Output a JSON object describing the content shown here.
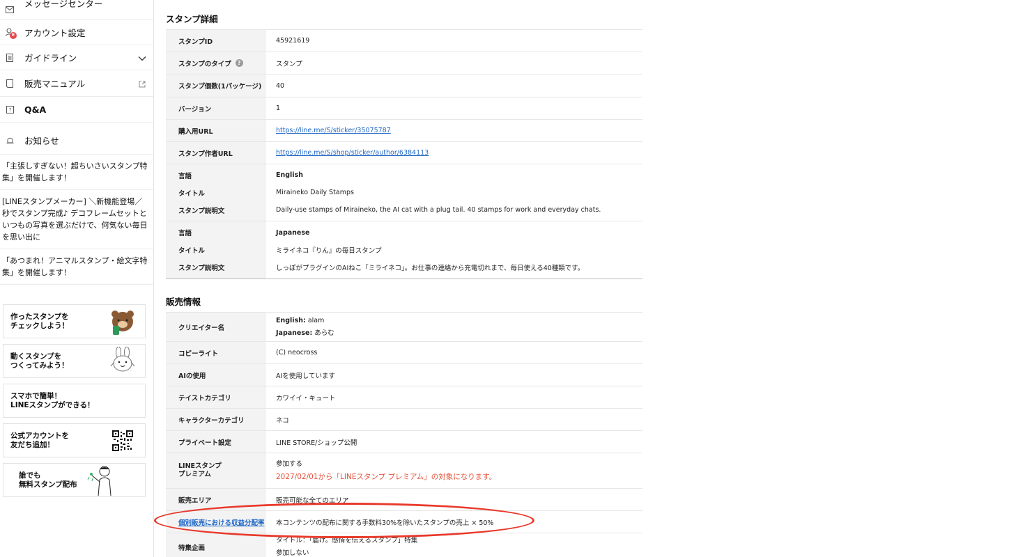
{
  "sidebar": {
    "nav": [
      {
        "label": "メッセージセンター",
        "icon": "mail-icon"
      },
      {
        "label": "アカウント設定",
        "icon": "account-icon",
        "badge": "E"
      },
      {
        "label": "ガイドライン",
        "icon": "document-icon"
      },
      {
        "label": "販売マニュアル",
        "icon": "book-icon"
      },
      {
        "label": "Q&A",
        "icon": "question-icon"
      },
      {
        "label": "お知らせ",
        "icon": "bell-icon"
      }
    ],
    "news": [
      "「主張しすぎない！超ちいさいスタンプ特集」を開催します！",
      "[LINEスタンプメーカー] ＼新機能登場／秒でスタンプ完成♪ デコフレームセットといつもの写真を選ぶだけで、何気ない毎日を思い出に",
      "「あつまれ！アニマルスタンプ・絵文字特集」を開催します！"
    ],
    "banners": [
      {
        "text": "作ったスタンプを\nチェックしよう！",
        "icon": "brown-bear-icon"
      },
      {
        "text": "動くスタンプを\nつくってみよう！",
        "icon": "cony-rabbit-icon"
      },
      {
        "text": "スマホで簡単！\nLINEスタンプができる！",
        "icon": ""
      },
      {
        "text": "公式アカウントを\n友だち追加！",
        "icon": "qr-code-icon"
      },
      {
        "text": "誰でも\n無料スタンプ配布",
        "icon": "person-illustration-icon"
      }
    ]
  },
  "details": {
    "title": "スタンプ詳細",
    "sticker_id_label": "スタンプID",
    "sticker_id": "45921619",
    "type_label": "スタンプのタイプ",
    "type": "スタンプ",
    "count_label": "スタンプ個数(1パッケージ)",
    "count": "40",
    "version_label": "バージョン",
    "version": "1",
    "purchase_url_label": "購入用URL",
    "purchase_url": "https://line.me/S/sticker/35075787",
    "author_url_label": "スタンプ作者URL",
    "author_url": "https://line.me/S/shop/sticker/author/6384113",
    "lang_label": "言語",
    "title_label": "タイトル",
    "desc_label": "スタンプ説明文",
    "english": {
      "language": "English",
      "title": "Miraineko Daily Stamps",
      "description": "Daily-use stamps of Miraineko, the AI cat with a plug tail. 40 stamps for work and everyday chats."
    },
    "japanese": {
      "language": "Japanese",
      "title": "ミライネコ『りん』の毎日スタンプ",
      "description": "しっぽがプラグインのAIねこ「ミライネコ」。お仕事の連絡から充電切れまで、毎日使える40種類です。"
    }
  },
  "sales": {
    "title": "販売情報",
    "creator_label": "クリエイター名",
    "creator_en_key": "English:",
    "creator_en": "alam",
    "creator_ja_key": "Japanese:",
    "creator_ja": "あらむ",
    "copyright_label": "コピーライト",
    "copyright": "(C) neocross",
    "ai_label": "AIの使用",
    "ai": "AIを使用しています",
    "taste_label": "テイストカテゴリ",
    "taste": "カワイイ・キュート",
    "character_label": "キャラクターカテゴリ",
    "character": "ネコ",
    "private_label": "プライベート設定",
    "private": "LINE STORE/ショップ公開",
    "premium_label": "LINEスタンプ\nプレミアム",
    "premium": "参加する",
    "premium_note": "2027/02/01から「LINEスタンプ プレミアム」の対象になります。",
    "area_label": "販売エリア",
    "area": "販売可能な全てのエリア",
    "revenue_label": "個別販売における収益分配率",
    "revenue": "本コンテンツの配布に関する手数料30%を除いたスタンプの売上 × 50%",
    "feature_label": "特集企画",
    "feature": "タイトル：「届け。感情を伝えるスタンプ」特集",
    "feature_status": "参加しない"
  },
  "colors": {
    "link": "#1e66c6",
    "highlight_oval": "#e8392b",
    "premium_note": "#e5533d",
    "badge": "#e5484d"
  }
}
